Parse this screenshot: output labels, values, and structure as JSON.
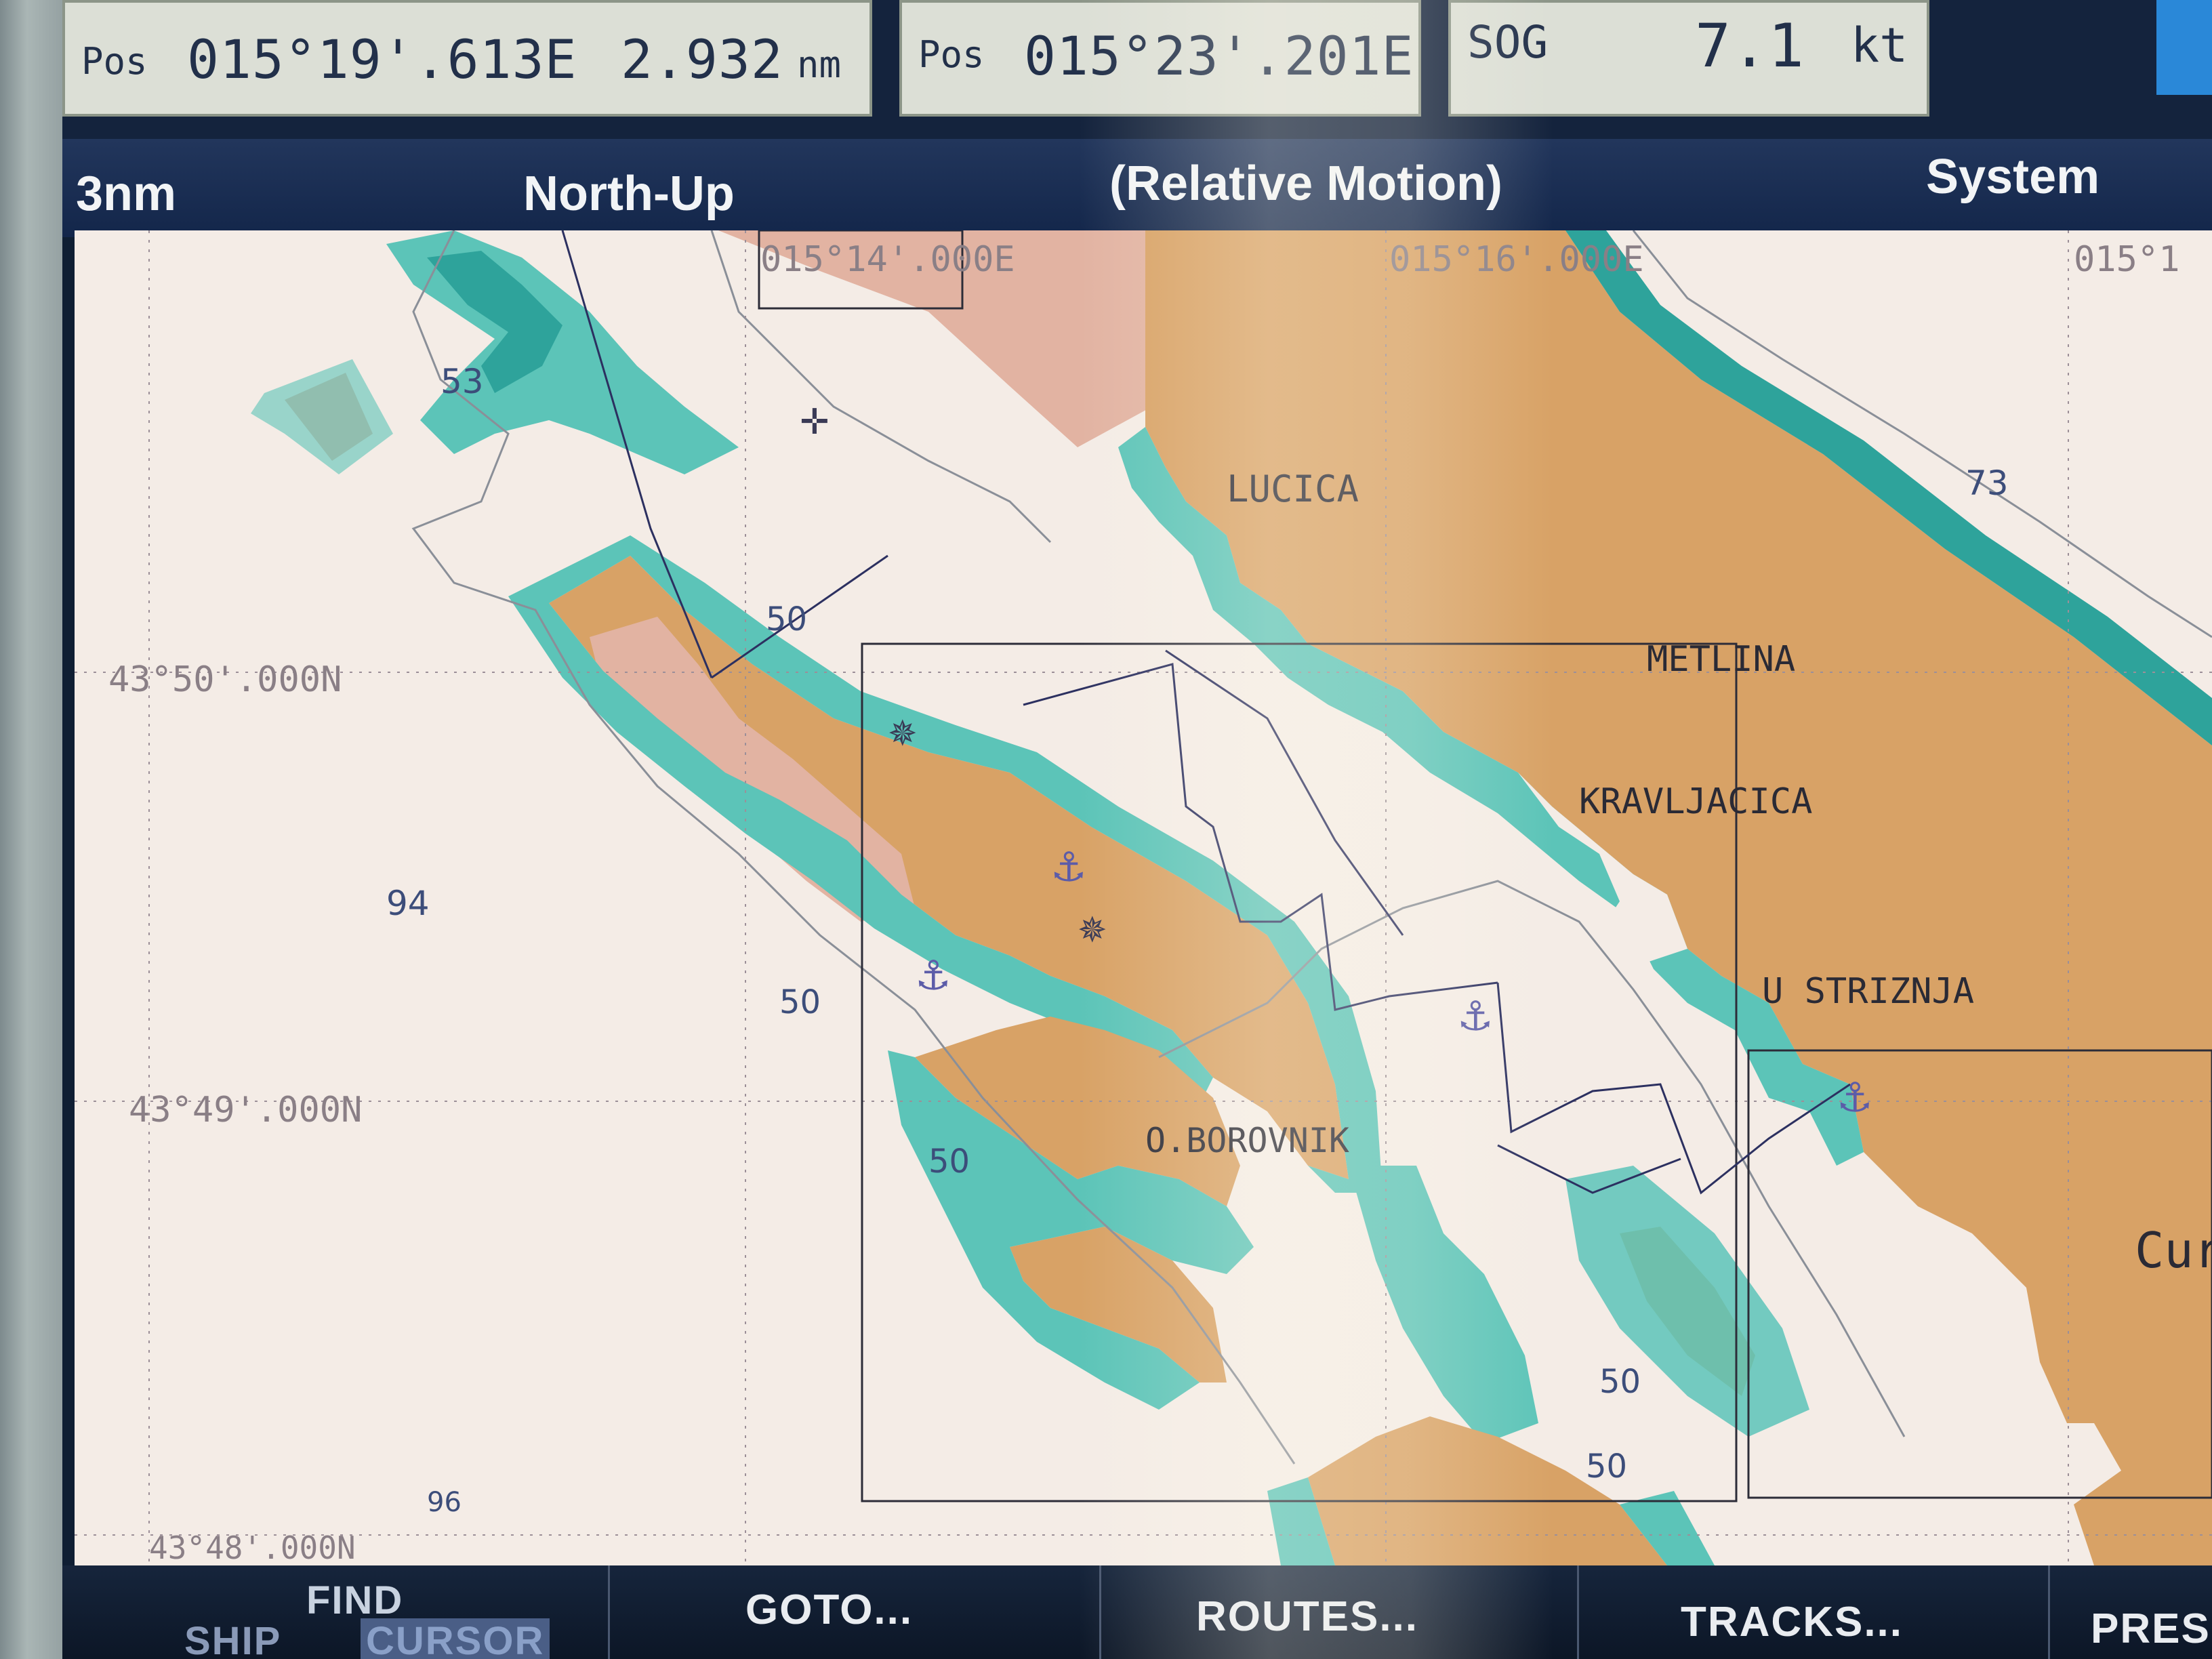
{
  "databar": {
    "box1_label": "Pos",
    "box1_position": "015°19'.613E",
    "box1_distance": "2.932",
    "box1_unit": "nm",
    "box2_label": "Pos",
    "box2_position": "015°23'.201E",
    "box3_label": "SOG",
    "box3_value": "7.1",
    "box3_unit": "kt"
  },
  "statusbar": {
    "range": "3nm",
    "orientation": "North-Up",
    "motion_mode": "(Relative Motion)",
    "system": "System"
  },
  "chart": {
    "grid_labels": {
      "lon_1": "015°14'.000E",
      "lon_2": "015°16'.000E",
      "lon_3": "015°1",
      "lat_1": "43°50'.000N",
      "lat_2": "43°49'.000N",
      "lat_3": "43°48'.000N"
    },
    "place_names": {
      "lucica": "LUCICA",
      "metlina": "METLINA",
      "kravljacica": "KRAVLJACICA",
      "striznja": "U STRIZNJA",
      "borovnik": "O.BOROVNIK",
      "cut": "Cur"
    },
    "depths": {
      "d53": "53",
      "d73": "73",
      "d94": "94",
      "d96": "96",
      "d50_a": "50",
      "d50_b": "50",
      "d50_c": "50",
      "d50_d": "50",
      "d50_e": "50"
    },
    "colors": {
      "land": "#d8a266",
      "land_pink": "#e2b3a2",
      "shallow": "#5cc4b8",
      "shallow_dark": "#2ea39b",
      "water": "#f4ece6"
    }
  },
  "softkeys": {
    "find_top": "FIND",
    "find_ship": "SHIP",
    "find_cursor": "CURSOR",
    "goto": "GOTO...",
    "routes": "ROUTES...",
    "tracks": "TRACKS...",
    "presets": "PRESE"
  }
}
